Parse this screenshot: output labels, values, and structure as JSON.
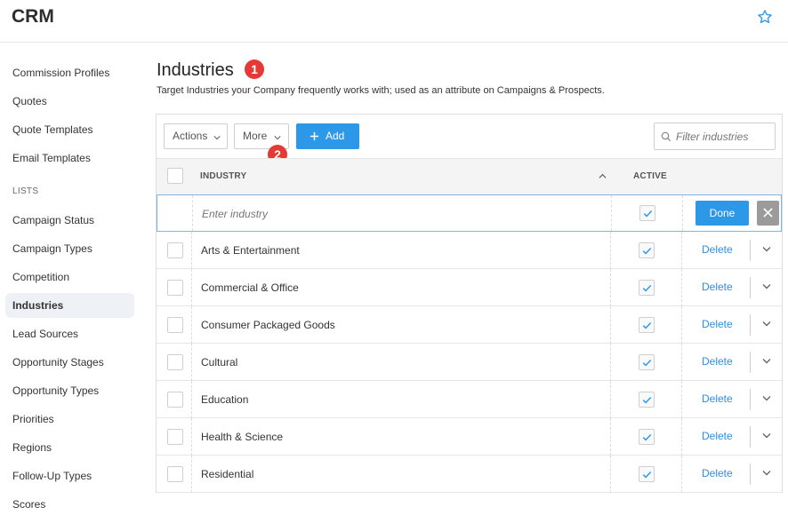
{
  "app": {
    "title": "CRM"
  },
  "sidebar": {
    "items_top": [
      {
        "label": "Commission Profiles"
      },
      {
        "label": "Quotes"
      },
      {
        "label": "Quote Templates"
      },
      {
        "label": "Email Templates"
      }
    ],
    "section_label": "LISTS",
    "items_lists": [
      {
        "label": "Campaign Status"
      },
      {
        "label": "Campaign Types"
      },
      {
        "label": "Competition"
      },
      {
        "label": "Industries",
        "active": true
      },
      {
        "label": "Lead Sources"
      },
      {
        "label": "Opportunity Stages"
      },
      {
        "label": "Opportunity Types"
      },
      {
        "label": "Priorities"
      },
      {
        "label": "Regions"
      },
      {
        "label": "Follow-Up Types"
      },
      {
        "label": "Scores"
      }
    ]
  },
  "page": {
    "title": "Industries",
    "subtitle": "Target Industries your Company frequently works with; used as an attribute on Campaigns & Prospects.",
    "badges": [
      "1",
      "2"
    ]
  },
  "toolbar": {
    "actions_label": "Actions",
    "more_label": "More",
    "add_label": "Add",
    "filter_placeholder": "Filter industries"
  },
  "table": {
    "col_industry": "INDUSTRY",
    "col_active": "ACTIVE",
    "new_row_placeholder": "Enter industry",
    "new_row_active": true,
    "done_label": "Done",
    "delete_label": "Delete",
    "rows": [
      {
        "name": "Arts & Entertainment",
        "active": true
      },
      {
        "name": "Commercial & Office",
        "active": true
      },
      {
        "name": "Consumer Packaged Goods",
        "active": true
      },
      {
        "name": "Cultural",
        "active": true
      },
      {
        "name": "Education",
        "active": true
      },
      {
        "name": "Health & Science",
        "active": true
      },
      {
        "name": "Residential",
        "active": true
      }
    ]
  },
  "colors": {
    "accent": "#2d97e8",
    "badge": "#e53935",
    "link": "#2d8ee0"
  }
}
